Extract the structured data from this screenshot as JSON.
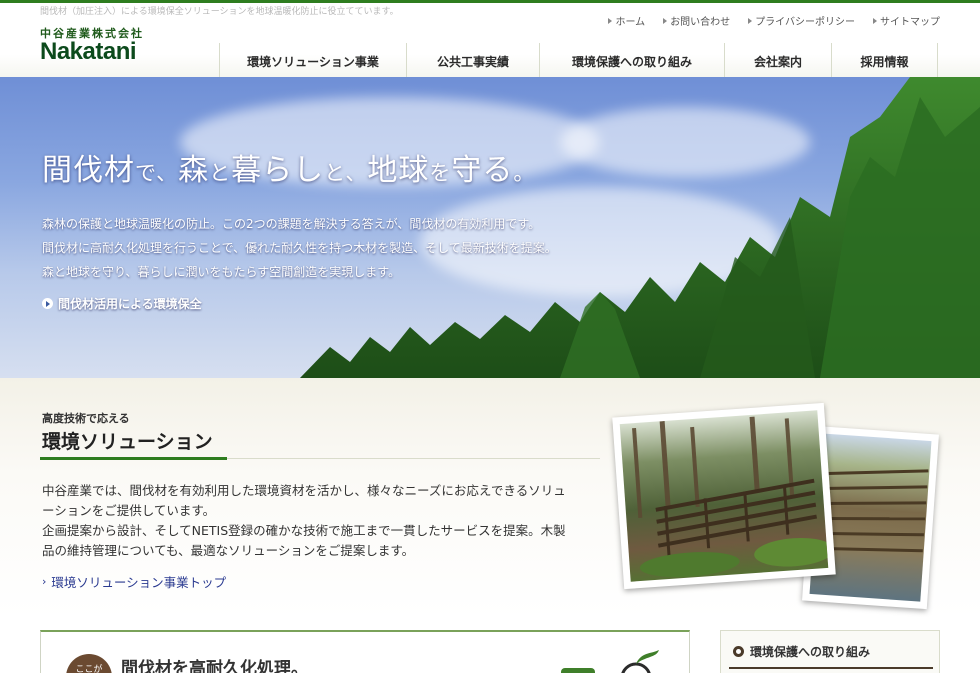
{
  "header": {
    "tagline": "間伐材（加圧注入）による環境保全ソリューションを地球温暖化防止に役立てています。",
    "logo_ja": "中谷産業株式会社",
    "logo_en": "Nakatani",
    "util_nav": [
      {
        "label": "ホーム"
      },
      {
        "label": "お問い合わせ"
      },
      {
        "label": "プライバシーポリシー"
      },
      {
        "label": "サイトマップ"
      }
    ],
    "global_nav": [
      {
        "label": "環境ソリューション事業"
      },
      {
        "label": "公共工事実績"
      },
      {
        "label": "環境保護への取り組み"
      },
      {
        "label": "会社案内"
      },
      {
        "label": "採用情報"
      }
    ]
  },
  "hero": {
    "title_parts": [
      "間伐材",
      "で、",
      "森",
      "と",
      "暮らし",
      "と、",
      "地球",
      "を",
      "守る",
      "。"
    ],
    "lines": [
      "森林の保護と地球温暖化の防止。この2つの課題を解決する答えが、間伐材の有効利用です。",
      "間伐材に高耐久化処理を行うことで、優れた耐久性を持つ木材を製造、そして最新技術を提案。",
      "森と地球を守り、暮らしに潤いをもたらす空間創造を実現します。"
    ],
    "link_label": "間伐材活用による環境保全"
  },
  "solution": {
    "subtitle": "高度技術で応える",
    "title": "環境ソリューション",
    "body": [
      "中谷産業では、間伐材を有効利用した環境資材を活かし、様々なニーズにお応えできるソリュ",
      "ーションをご提供しています。",
      "企画提案から設計、そしてNETIS登録の確かな技術で施工まで一貫したサービスを提案。木製",
      "品の維持管理についても、最適なソリューションをご提案します。"
    ],
    "link_label": "環境ソリューション事業トップ"
  },
  "feature": {
    "badge": "ここが",
    "title": "間伐材を高耐久化処理。"
  },
  "side": {
    "title": "環境保護への取り組み"
  }
}
